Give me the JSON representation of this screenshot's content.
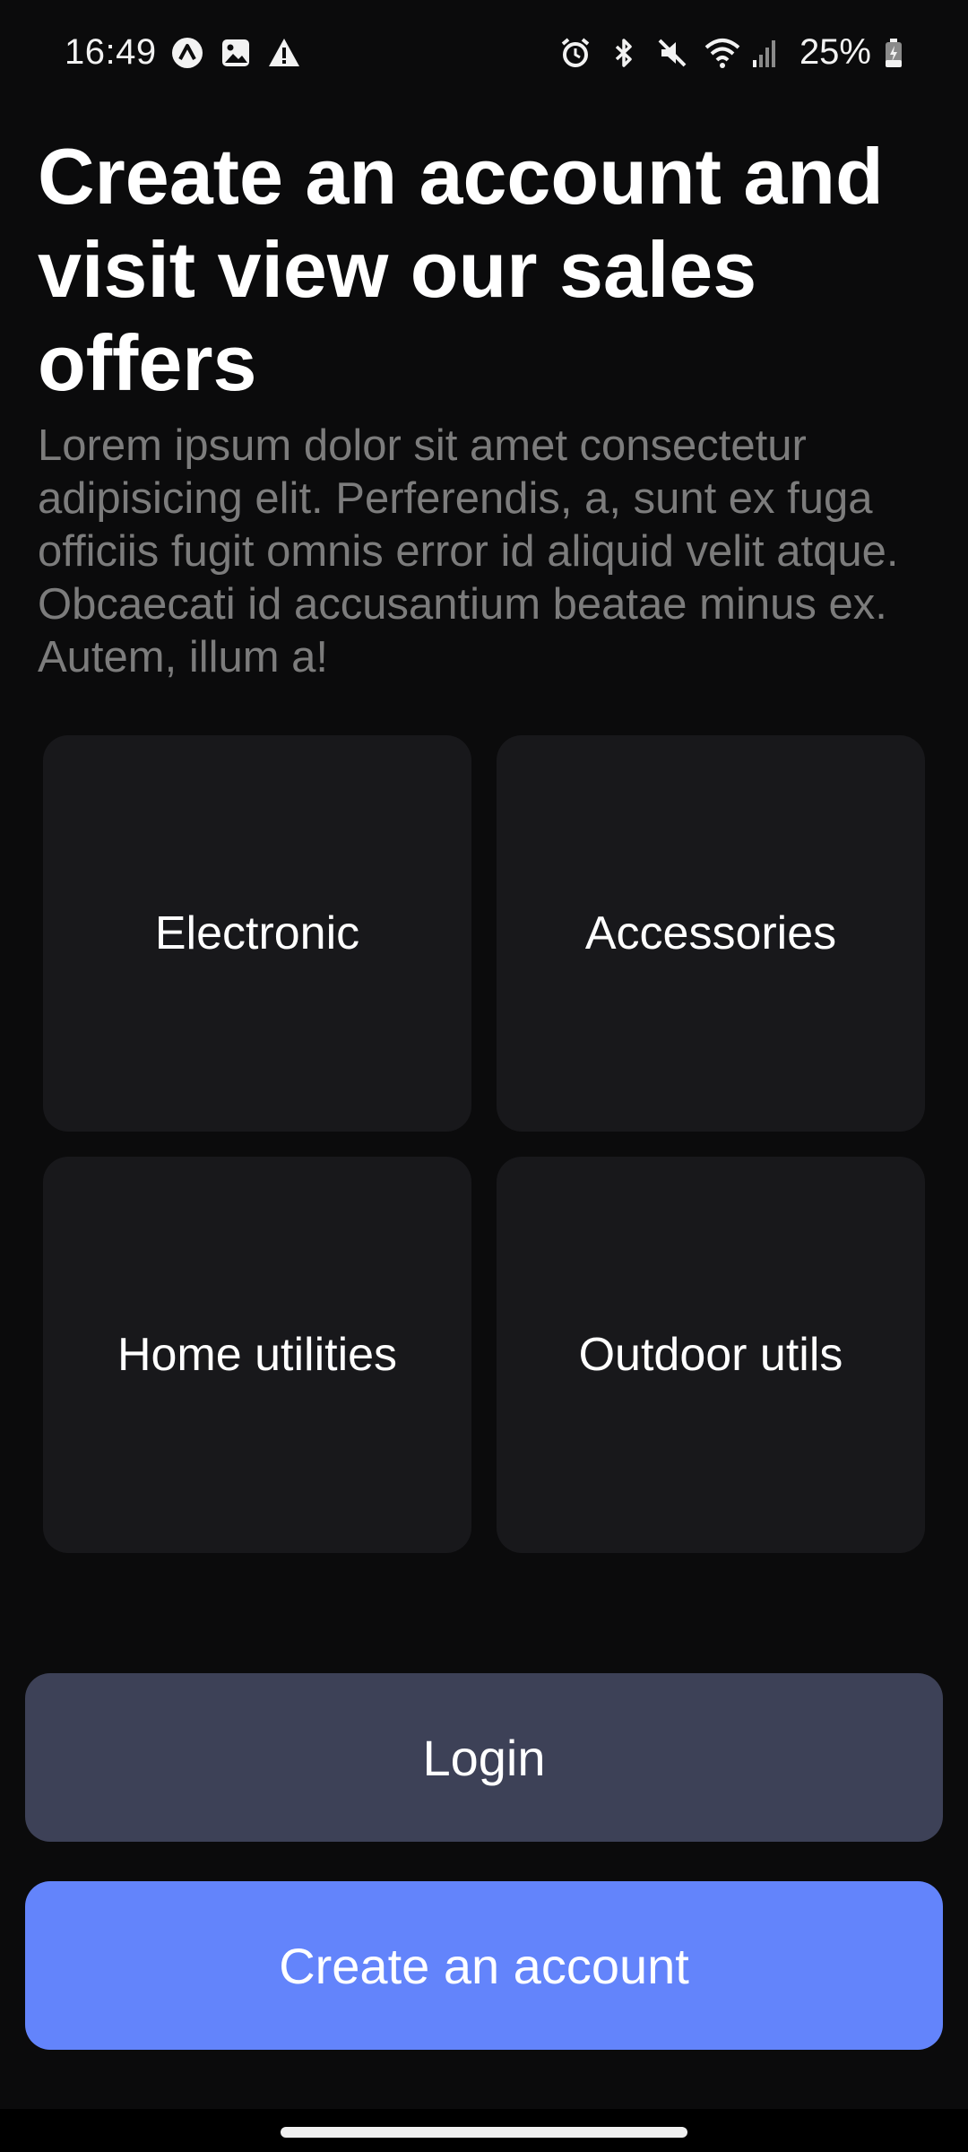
{
  "status_bar": {
    "time": "16:49",
    "battery": "25%",
    "icons_left": [
      "nearby-share-icon",
      "image-icon",
      "warning-icon"
    ],
    "icons_right": [
      "alarm-icon",
      "bluetooth-icon",
      "mute-icon",
      "wifi-icon",
      "signal-icon",
      "battery-icon"
    ]
  },
  "header": {
    "title": "Create an account and visit view our sales offers",
    "description": "Lorem ipsum dolor sit amet consectetur adipisicing elit. Perferendis, a, sunt ex fuga officiis fugit omnis error id aliquid velit atque. Obcaecati id accusantium beatae minus ex. Autem, illum a!"
  },
  "categories": [
    {
      "label": "Electronic"
    },
    {
      "label": "Accessories"
    },
    {
      "label": "Home utilities"
    },
    {
      "label": "Outdoor utils"
    }
  ],
  "actions": {
    "login_label": "Login",
    "create_label": "Create an account"
  },
  "colors": {
    "background": "#0b0b0c",
    "tile": "#18181b",
    "login_button": "#3d4157",
    "create_button": "#6384fb",
    "description_text": "#7c7c7c"
  }
}
